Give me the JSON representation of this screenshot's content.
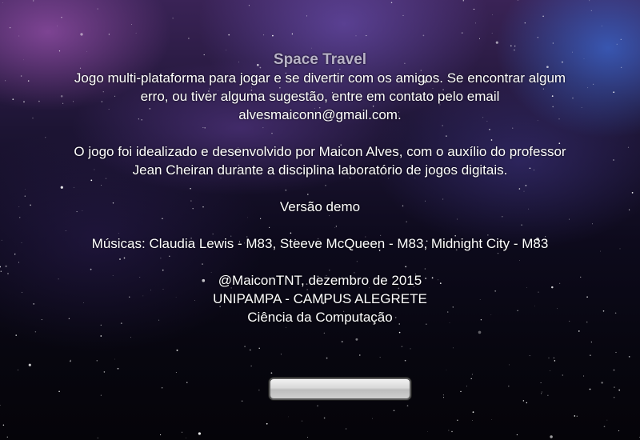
{
  "game": {
    "title": "Space Travel",
    "description_line1": "Jogo multi-plataforma para jogar e se divertir com os amigos. Se encontrar algum",
    "description_line2": "erro, ou tiver alguma  sugestão, entre em contato pelo email",
    "description_line3": "alvesmaiconn@gmail.com.",
    "credits_line1": "O jogo foi idealizado e desenvolvido por Maicon Alves, com o auxílio do professor",
    "credits_line2": "Jean Cheiran durante a disciplina laboratório de jogos digitais.",
    "version": "Versão demo",
    "music": "Músicas: Claudia Lewis - M83, Steeve McQueen - M83, Midnight City - M83",
    "author_date": "@MaiconTNT, dezembro de 2015",
    "institution": "UNIPAMPA - CAMPUS ALEGRETE",
    "course": "Ciência da Computação"
  },
  "back_button": {
    "label": ""
  },
  "colors": {
    "title": "#b9b3c8",
    "text": "#ffffff",
    "button_face": "#d8d8d8"
  }
}
